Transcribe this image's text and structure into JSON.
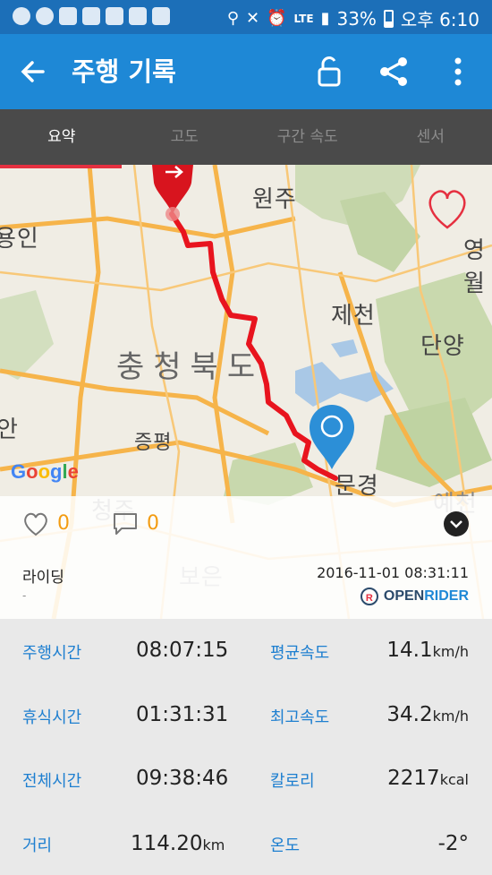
{
  "status_bar": {
    "battery": "33%",
    "time": "오후 6:10",
    "network": "LTE"
  },
  "app_bar": {
    "title": "주행 기록"
  },
  "tabs": [
    {
      "label": "요약",
      "active": true
    },
    {
      "label": "고도",
      "active": false
    },
    {
      "label": "구간 속도",
      "active": false
    },
    {
      "label": "센서",
      "active": false
    }
  ],
  "map": {
    "labels": {
      "wonju": "원주",
      "yongin": "용인",
      "yeongwol": "영월",
      "jecheon": "제천",
      "danyang": "단양",
      "chungbuk": "충청북도",
      "jeungpyeong": "증평",
      "mungyeong": "문경",
      "yecheon": "예천",
      "cheongju": "청주",
      "boeun": "보은",
      "an": "안"
    },
    "google": "Google"
  },
  "social": {
    "likes": "0",
    "comments": "0"
  },
  "activity": {
    "type": "라이딩",
    "subtitle": "-",
    "datetime": "2016-11-01 08:31:11"
  },
  "brand": {
    "open": "OPEN",
    "rider": "RIDER"
  },
  "stats": {
    "riding_time": {
      "label": "주행시간",
      "value": "08:07:15"
    },
    "rest_time": {
      "label": "휴식시간",
      "value": "01:31:31"
    },
    "total_time": {
      "label": "전체시간",
      "value": "09:38:46"
    },
    "distance": {
      "label": "거리",
      "value": "114.20",
      "unit": "km"
    },
    "avg_speed": {
      "label": "평균속도",
      "value": "14.1",
      "unit": "km/h"
    },
    "max_speed": {
      "label": "최고속도",
      "value": "34.2",
      "unit": "km/h"
    },
    "calories": {
      "label": "칼로리",
      "value": "2217",
      "unit": "kcal"
    },
    "temperature": {
      "label": "온도",
      "value": "-2°"
    }
  },
  "colors": {
    "primary": "#1e88d6",
    "status_bar": "#1c6fb8",
    "tab_bar": "#4a4a4a",
    "route": "#e8141e",
    "accent": "#f39c12",
    "label_blue": "#1e7fd0"
  }
}
